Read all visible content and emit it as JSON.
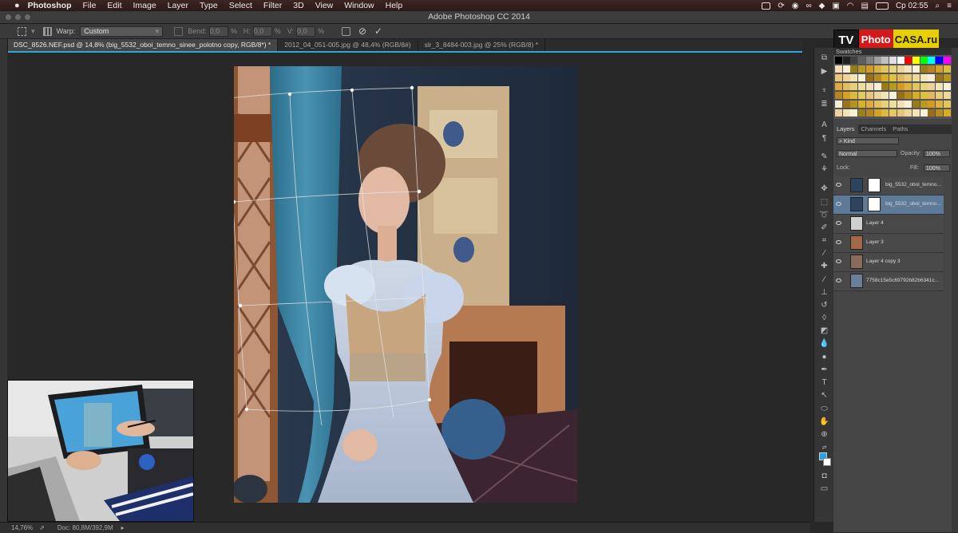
{
  "menubar": {
    "apple": "",
    "items": [
      "Photoshop",
      "File",
      "Edit",
      "Image",
      "Layer",
      "Type",
      "Select",
      "Filter",
      "3D",
      "View",
      "Window",
      "Help"
    ],
    "clock": "Ср 02:55"
  },
  "window": {
    "title": "Adobe Photoshop CC 2014"
  },
  "options": {
    "warp_label": "Warp:",
    "warp_value": "Custom",
    "bend_label": "Bend:",
    "bend_value": "0,0",
    "h_label": "H:",
    "h_value": "0,0",
    "v_label": "V:",
    "v_value": "0,0",
    "percent": "%"
  },
  "tabs": [
    {
      "label": "DSC_8526.NEF.psd @ 14,8% (big_5532_oboi_temno_sinee_polotno copy, RGB/8*) *",
      "active": true
    },
    {
      "label": "2012_04_051-005.jpg @ 48,4% (RGB/8#)",
      "active": false
    },
    {
      "label": "slr_3_8484-003.jpg @ 25% (RGB/8) *",
      "active": false
    }
  ],
  "status": {
    "zoom": "14,76%",
    "doc": "Doc: 80,8M/392,9M"
  },
  "logo": {
    "tv": "TV",
    "photo": "Photo",
    "casa": "CASA.ru"
  },
  "swatches_panel": {
    "tab": "Swatches"
  },
  "layers_panel": {
    "tabs": [
      "Layers",
      "Channels",
      "Paths"
    ],
    "kind": "Kind",
    "blend_mode": "Normal",
    "opacity_label": "Opacity:",
    "opacity": "100%",
    "lock_label": "Lock:",
    "fill_label": "Fill:",
    "fill": "100%",
    "layers": [
      {
        "name": "big_5532_oboi_temno...",
        "mask": true,
        "selected": false
      },
      {
        "name": "big_5532_oboi_temno...",
        "mask": true,
        "selected": true
      },
      {
        "name": "Layer 4",
        "mask": false,
        "selected": false
      },
      {
        "name": "Layer 3",
        "mask": false,
        "selected": false
      },
      {
        "name": "Layer 4 copy 3",
        "mask": false,
        "selected": false
      },
      {
        "name": "7758c15e5c69792b82b6341c...",
        "mask": false,
        "selected": false
      }
    ]
  }
}
